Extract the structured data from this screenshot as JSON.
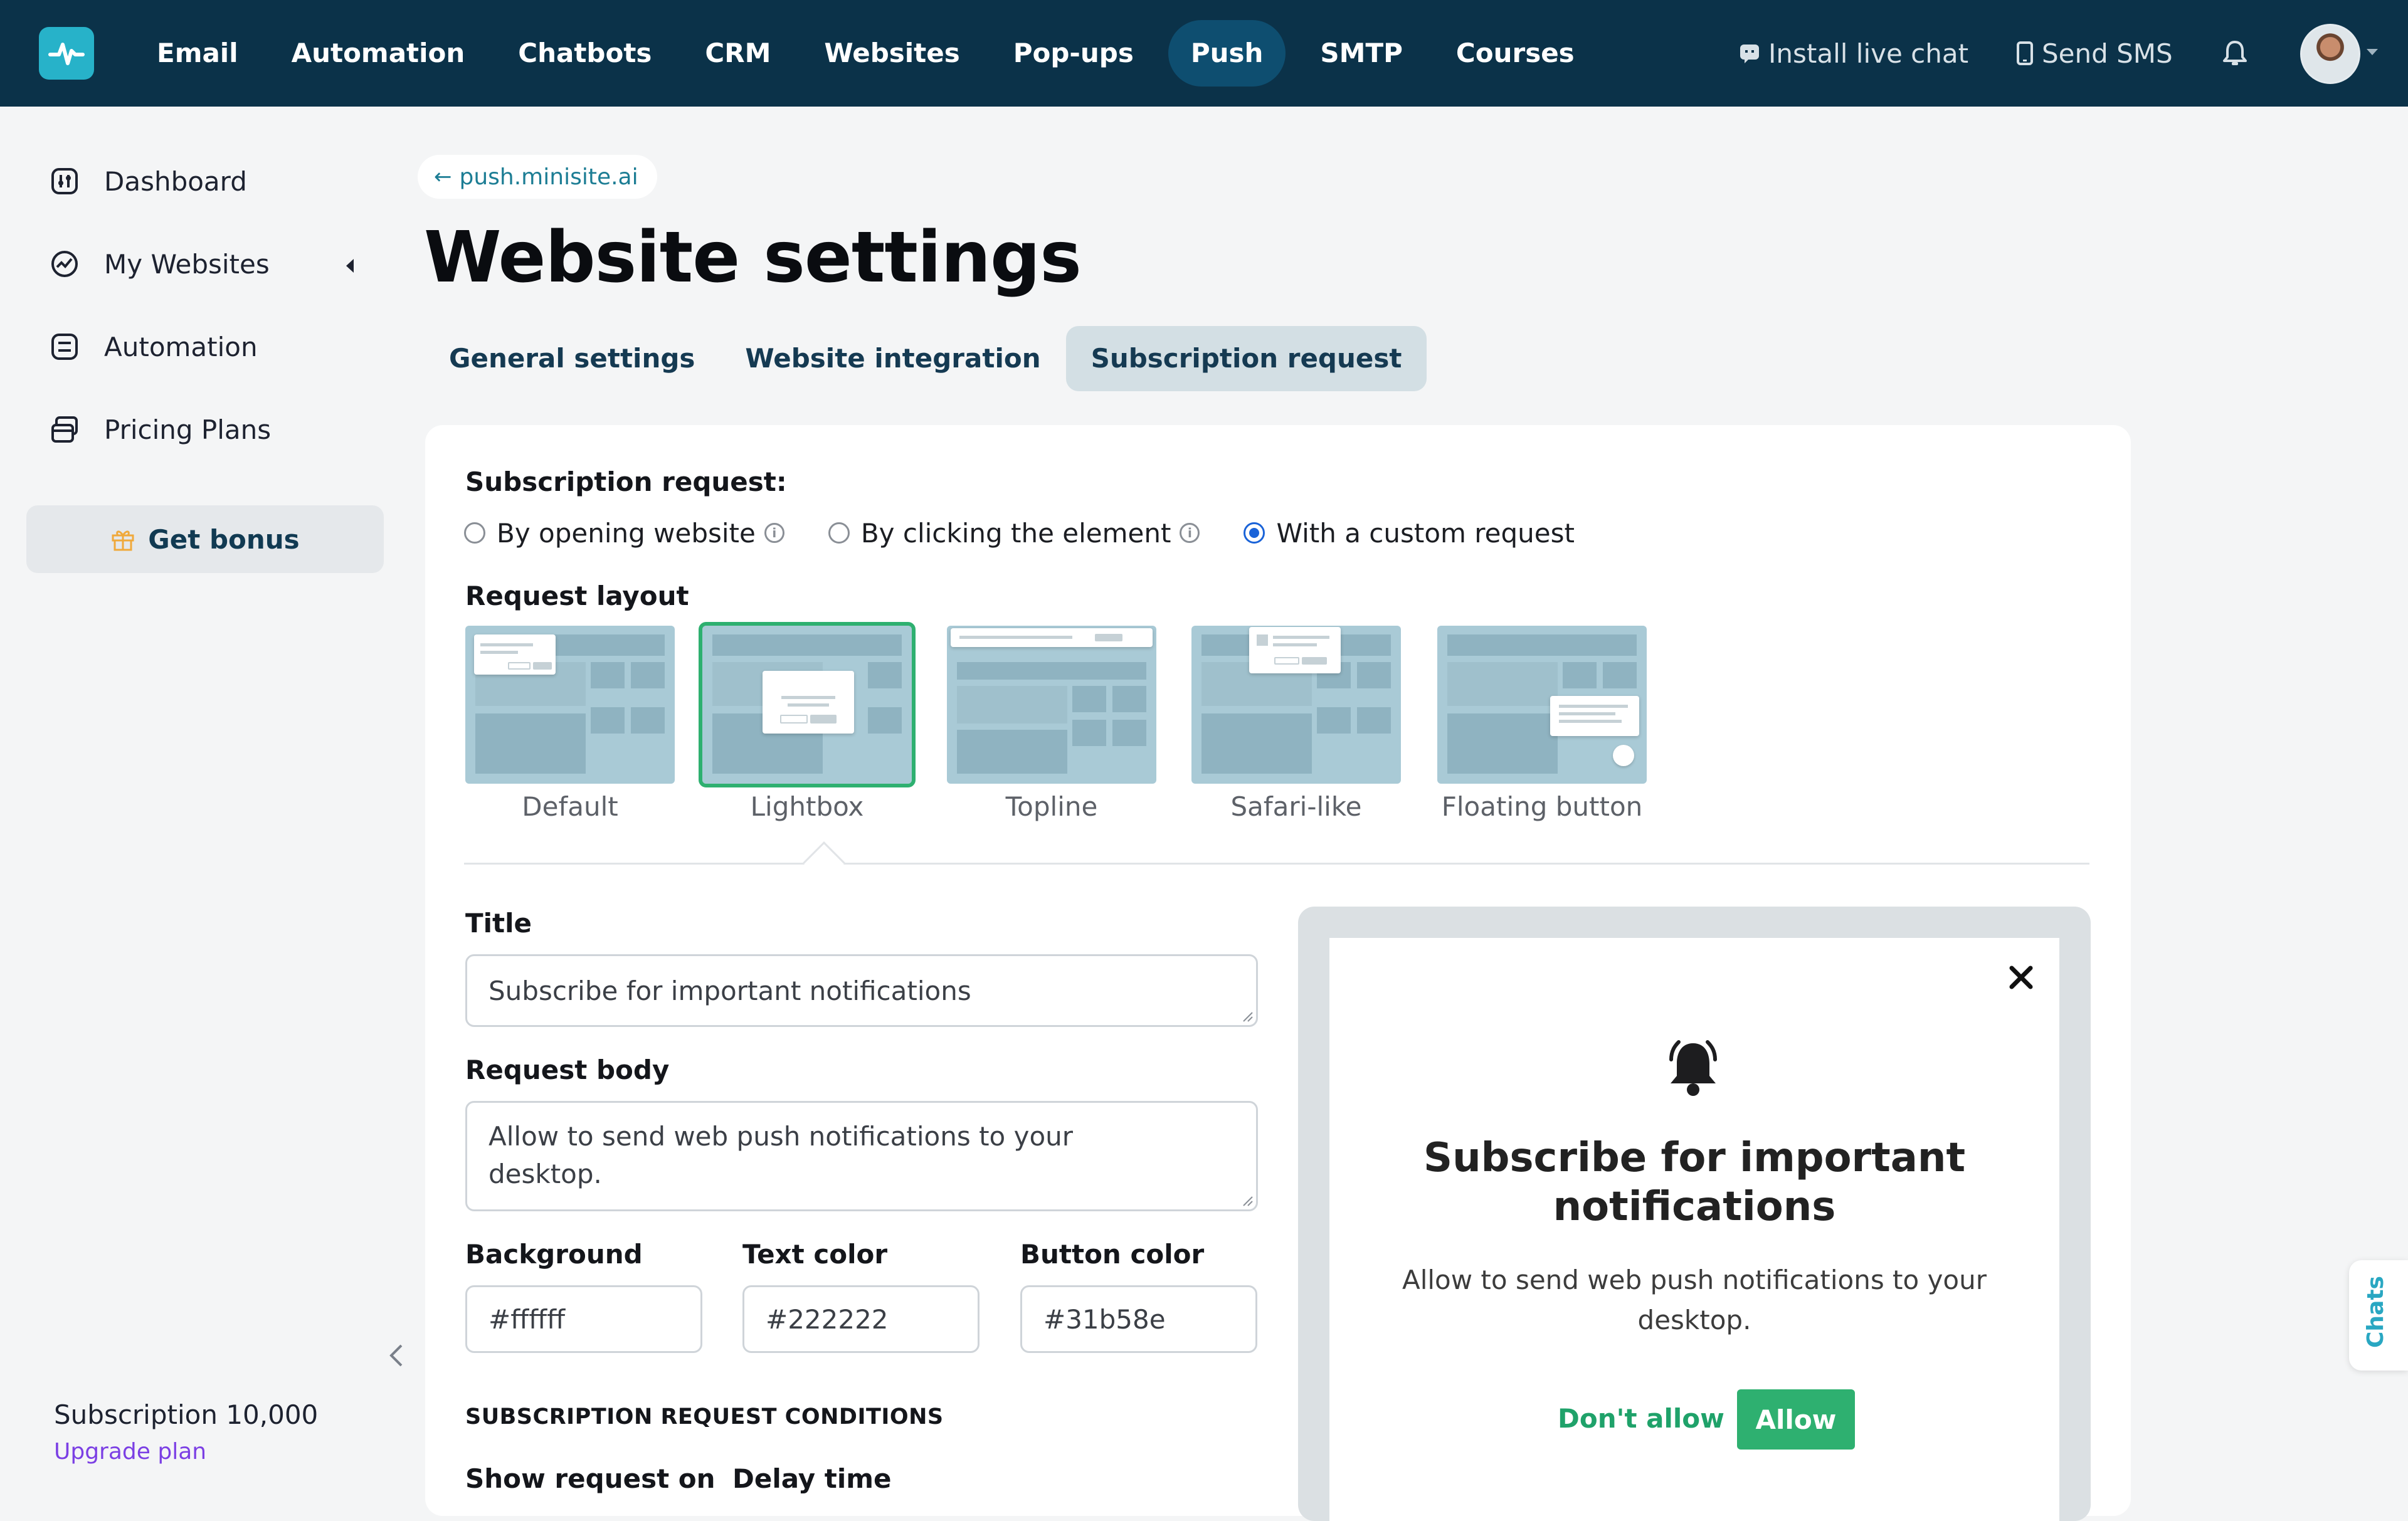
{
  "topnav": {
    "items": [
      {
        "label": "Email",
        "active": false
      },
      {
        "label": "Automation",
        "active": false
      },
      {
        "label": "Chatbots",
        "active": false
      },
      {
        "label": "CRM",
        "active": false
      },
      {
        "label": "Websites",
        "active": false
      },
      {
        "label": "Pop-ups",
        "active": false
      },
      {
        "label": "Push",
        "active": true
      },
      {
        "label": "SMTP",
        "active": false
      },
      {
        "label": "Courses",
        "active": false
      }
    ],
    "install_chat": "Install live chat",
    "send_sms": "Send SMS"
  },
  "sidebar": {
    "items": [
      {
        "label": "Dashboard",
        "icon": "dashboard-icon"
      },
      {
        "label": "My Websites",
        "icon": "websites-icon"
      },
      {
        "label": "Automation",
        "icon": "automation-icon"
      },
      {
        "label": "Pricing Plans",
        "icon": "pricing-icon"
      }
    ],
    "bonus": "Get bonus",
    "subscription": "Subscription 10,000",
    "upgrade": "Upgrade plan"
  },
  "header": {
    "back_link": "push.minisite.ai",
    "title": "Website settings",
    "tabs": [
      "General settings",
      "Website integration",
      "Subscription request"
    ],
    "active_tab": "Subscription request"
  },
  "form": {
    "subscription_label": "Subscription request:",
    "options": [
      "By opening website",
      "By clicking the element",
      "With a custom request"
    ],
    "selected_option": "With a custom request",
    "layout_label": "Request layout",
    "layouts": [
      "Default",
      "Lightbox",
      "Topline",
      "Safari-like",
      "Floating button"
    ],
    "selected_layout": "Lightbox",
    "title_label": "Title",
    "title_value": "Subscribe for important notifications",
    "body_label": "Request body",
    "body_value": "Allow to send web push notifications to your desktop.",
    "background_label": "Background",
    "background_value": "#ffffff",
    "text_color_label": "Text color",
    "text_color_value": "#222222",
    "button_color_label": "Button color",
    "button_color_value": "#31b58e",
    "conditions_heading": "SUBSCRIPTION REQUEST CONDITIONS",
    "show_on_label": "Show request on",
    "delay_label": "Delay time"
  },
  "preview": {
    "title": "Subscribe for important notifications",
    "body": "Allow to send web push notifications to your desktop.",
    "deny": "Don't allow",
    "allow": "Allow"
  },
  "chats_tab": "Chats",
  "colors": {
    "nav_bg": "#0b3249",
    "accent": "#2eb070",
    "link": "#1c7d94",
    "upgrade": "#7b3fe4"
  }
}
